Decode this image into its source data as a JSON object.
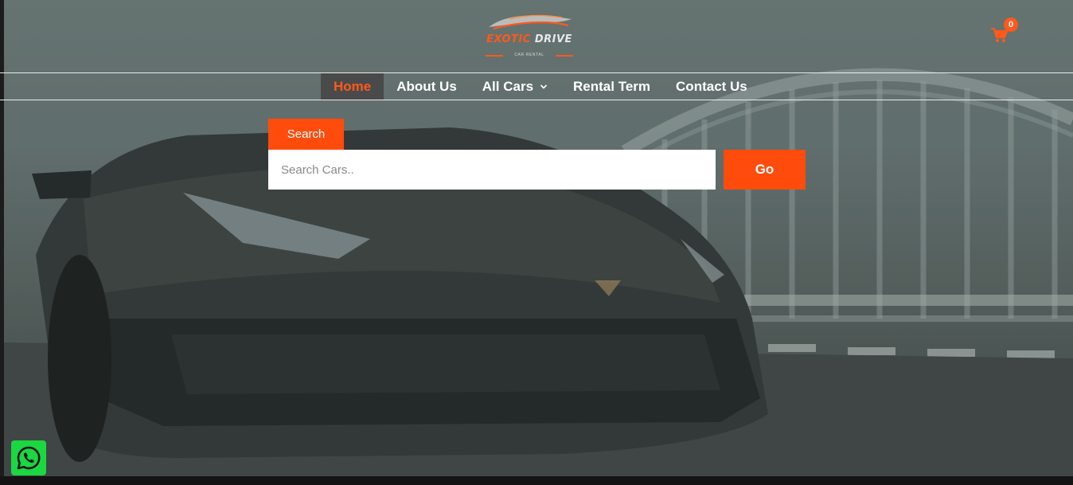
{
  "brand": {
    "name_part1": "EXOTIC",
    "name_part2": "DRIVE",
    "tagline": "CAR RENTAL"
  },
  "cart": {
    "count": "0",
    "icon": "cart-icon"
  },
  "nav": {
    "items": [
      {
        "label": "Home",
        "active": true
      },
      {
        "label": "About Us",
        "active": false
      },
      {
        "label": "All Cars",
        "active": false,
        "has_dropdown": true
      },
      {
        "label": "Rental Term",
        "active": false
      },
      {
        "label": "Contact Us",
        "active": false
      }
    ]
  },
  "search": {
    "tab_label": "Search",
    "placeholder": "Search Cars..",
    "value": "",
    "button_label": "Go"
  },
  "floating": {
    "whatsapp_icon": "whatsapp-icon"
  },
  "colors": {
    "accent": "#ff4c0d",
    "whatsapp": "#1bd741",
    "nav_active_bg": "#4a4a4a"
  }
}
